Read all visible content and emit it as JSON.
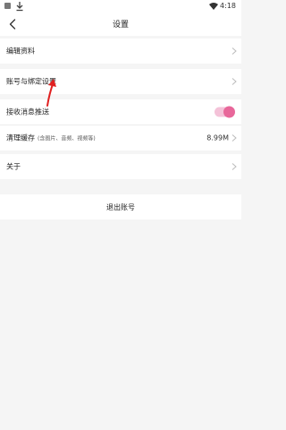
{
  "status_bar": {
    "time": "4:18",
    "icons": [
      "app-icon",
      "download-icon",
      "wifi-icon"
    ]
  },
  "header": {
    "title": "设置",
    "back_icon": "chevron-left-icon"
  },
  "settings": {
    "edit_profile": "编辑资料",
    "account_binding": "账号与绑定设置",
    "push_notifications": {
      "label": "接收消息推送",
      "enabled": true
    },
    "clear_cache": {
      "label": "清理缓存",
      "sub": "(含图片、音频、视频等)",
      "value": "8.99M"
    },
    "about": "关于"
  },
  "logout": {
    "label": "退出账号"
  },
  "colors": {
    "accent": "#e8679a",
    "toggle_track": "#f4c2d8",
    "annotation": "#e02020",
    "background": "#f5f5f5"
  }
}
